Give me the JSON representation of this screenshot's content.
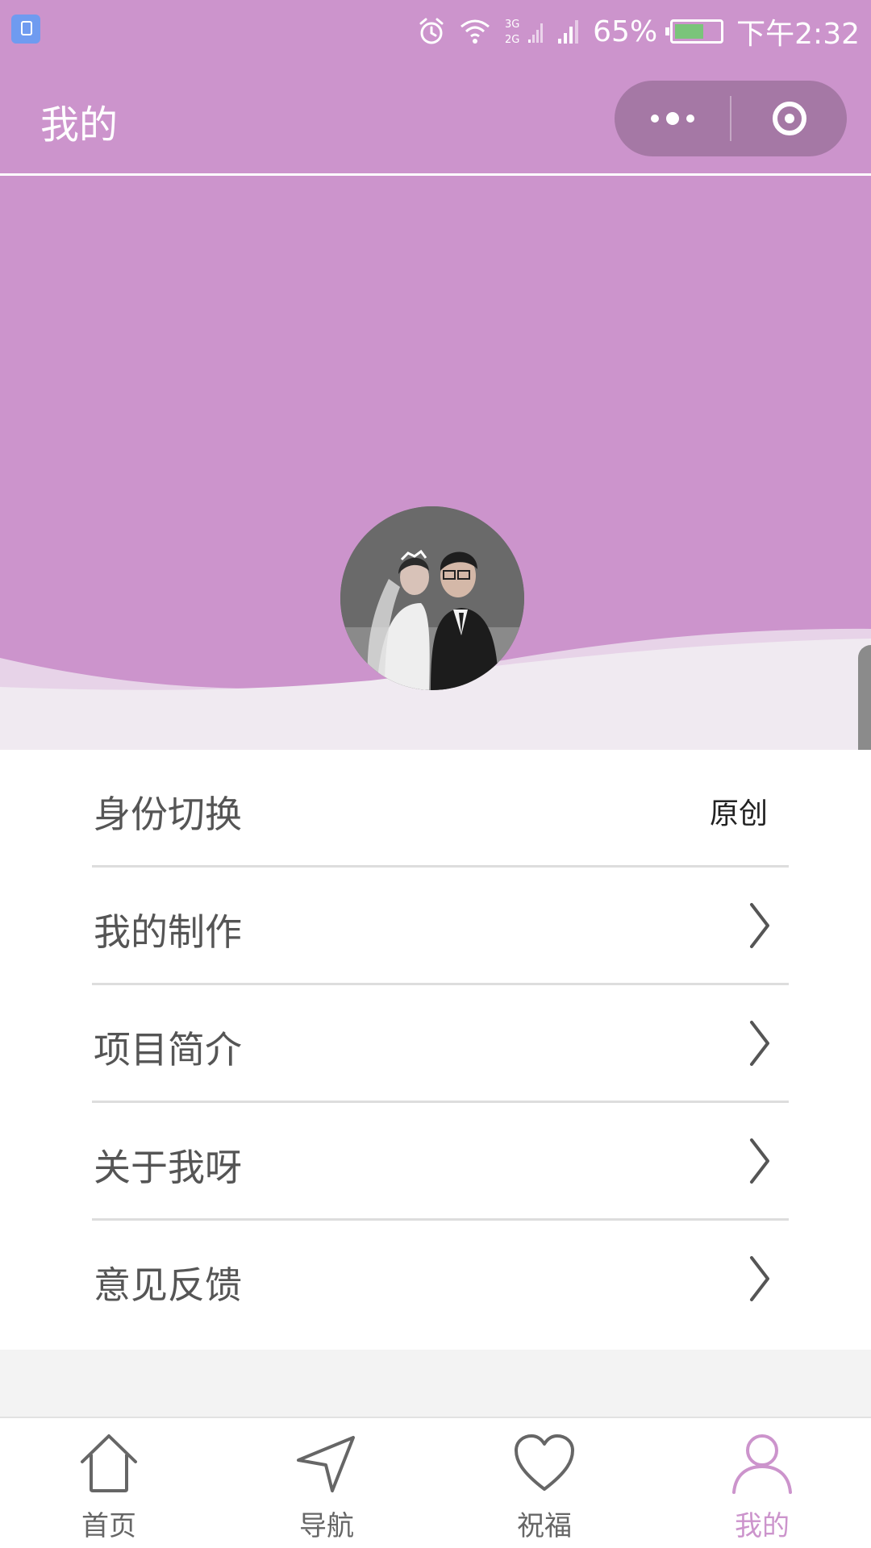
{
  "status_bar": {
    "battery_percent_text": "65%",
    "battery_level": 0.65,
    "time": "下午2:32",
    "network_top": "3G",
    "network_bottom": "2G",
    "icons": [
      "app-notification-icon",
      "alarm-icon",
      "wifi-icon",
      "dual-sim-signal-icon",
      "signal-icon",
      "battery-icon"
    ]
  },
  "title_bar": {
    "title": "我的",
    "capsule_icons": [
      "more-icon",
      "close-miniprogram-icon"
    ]
  },
  "hero": {
    "avatar": "couple-avatar",
    "colors": {
      "background": "#cc94cc",
      "wave_light": "#e7d3e8",
      "wave_lighter": "#f0eaf1"
    }
  },
  "menu": {
    "items": [
      {
        "label": "身份切换",
        "value": "原创",
        "icon": ""
      },
      {
        "label": "我的制作",
        "value": "",
        "icon": "chevron-right-icon"
      },
      {
        "label": "项目简介",
        "value": "",
        "icon": "chevron-right-icon"
      },
      {
        "label": "关于我呀",
        "value": "",
        "icon": "chevron-right-icon"
      },
      {
        "label": "意见反馈",
        "value": "",
        "icon": "chevron-right-icon"
      }
    ]
  },
  "tab_bar": {
    "tabs": [
      {
        "label": "首页",
        "icon": "home-icon",
        "active": false
      },
      {
        "label": "导航",
        "icon": "navigation-icon",
        "active": false
      },
      {
        "label": "祝福",
        "icon": "heart-icon",
        "active": false
      },
      {
        "label": "我的",
        "icon": "user-icon",
        "active": true
      }
    ],
    "active_color": "#cc94cc",
    "inactive_color": "#666666"
  }
}
